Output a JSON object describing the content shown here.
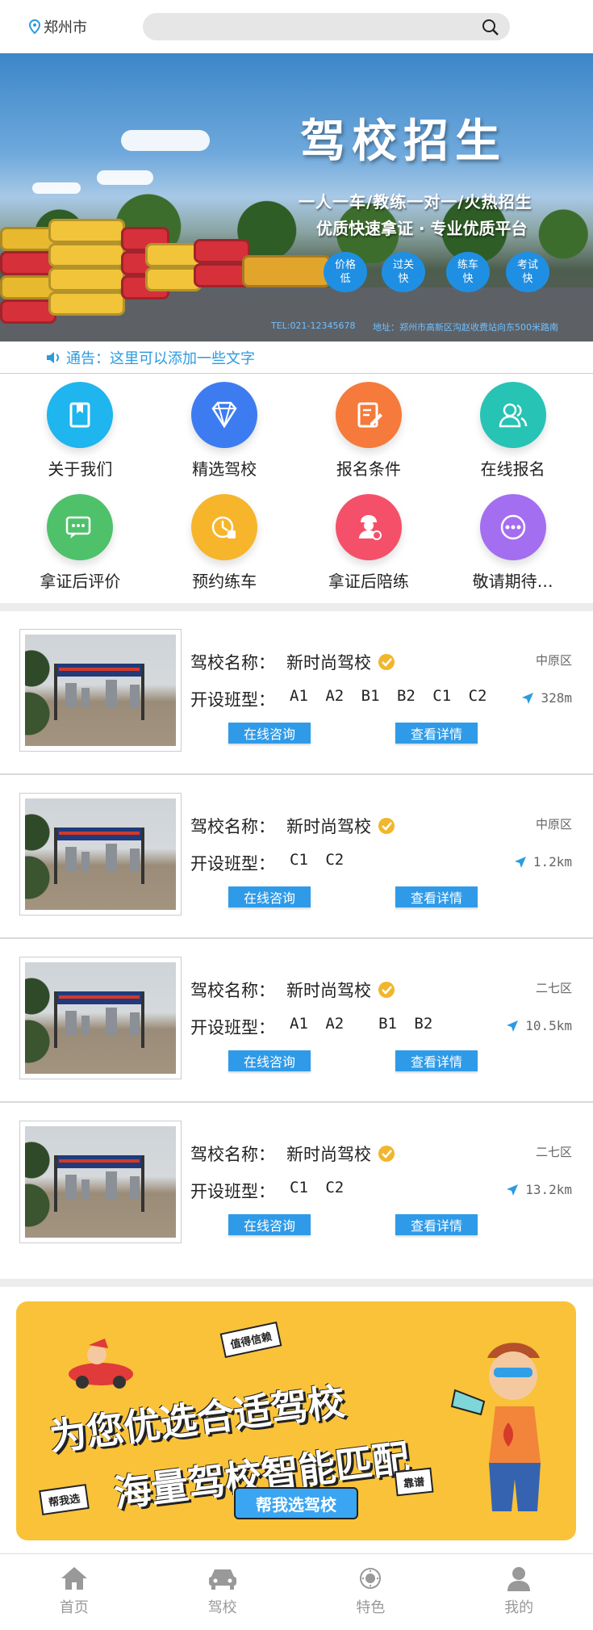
{
  "header": {
    "city": "郑州市",
    "search_icon": "search-icon"
  },
  "banner": {
    "title": "驾校招生",
    "subtitle1": "一人一车/教练一对一/火热招生",
    "subtitle2": "优质快速拿证 · 专业优质平台",
    "badges": [
      "价格低",
      "过关快",
      "练车快",
      "考试快"
    ],
    "tel": "TEL:021-12345678",
    "address": "地址：郑州市高新区沟赵收费站向东500米路南"
  },
  "notice": {
    "text": "通告：这里可以添加一些文字"
  },
  "grid": [
    {
      "label": "关于我们",
      "icon": "book-icon",
      "color": "#1fb5ee"
    },
    {
      "label": "精选驾校",
      "icon": "diamond-icon",
      "color": "#3d7cf0"
    },
    {
      "label": "报名条件",
      "icon": "form-edit-icon",
      "color": "#f57a3b"
    },
    {
      "label": "在线报名",
      "icon": "users-icon",
      "color": "#27c3b5"
    },
    {
      "label": "拿证后评价",
      "icon": "chat-icon",
      "color": "#4fc16b"
    },
    {
      "label": "预约练车",
      "icon": "clock-icon",
      "color": "#f7b52c"
    },
    {
      "label": "拿证后陪练",
      "icon": "instructor-icon",
      "color": "#f4506a"
    },
    {
      "label": "敬请期待…",
      "icon": "more-icon",
      "color": "#a46ef0"
    }
  ],
  "schools": [
    {
      "name_label": "驾校名称：",
      "name": "新时尚驾校",
      "class_label": "开设班型：",
      "classes": "A1 A2 B1 B2 C1 C2",
      "district": "中原区",
      "distance": "328m",
      "consult": "在线咨询",
      "detail": "查看详情"
    },
    {
      "name_label": "驾校名称：",
      "name": "新时尚驾校",
      "class_label": "开设班型：",
      "classes": "C1 C2",
      "district": "中原区",
      "distance": "1.2km",
      "consult": "在线咨询",
      "detail": "查看详情"
    },
    {
      "name_label": "驾校名称：",
      "name": "新时尚驾校",
      "class_label": "开设班型：",
      "classes": "A1 A2  B1 B2",
      "district": "二七区",
      "distance": "10.5km",
      "consult": "在线咨询",
      "detail": "查看详情"
    },
    {
      "name_label": "驾校名称：",
      "name": "新时尚驾校",
      "class_label": "开设班型：",
      "classes": "C1 C2",
      "district": "二七区",
      "distance": "13.2km",
      "consult": "在线咨询",
      "detail": "查看详情"
    }
  ],
  "promo": {
    "line1": "为您优选合适驾校",
    "line2": "海量驾校智能匹配",
    "tag1": "值得信赖",
    "tag2": "帮我选",
    "tag3": "靠谱",
    "button": "帮我选驾校"
  },
  "tabbar": [
    {
      "label": "首页",
      "icon": "home-icon"
    },
    {
      "label": "驾校",
      "icon": "car-icon"
    },
    {
      "label": "特色",
      "icon": "sun-icon"
    },
    {
      "label": "我的",
      "icon": "user-icon"
    }
  ]
}
